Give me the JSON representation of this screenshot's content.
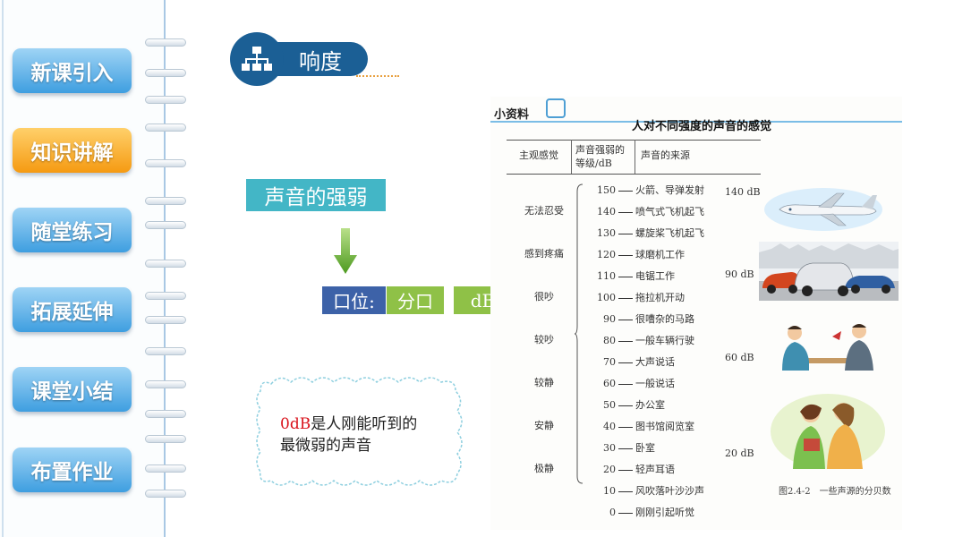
{
  "nav": {
    "items": [
      {
        "label": "新课引入",
        "active": false
      },
      {
        "label": "知识讲解",
        "active": true
      },
      {
        "label": "随堂练习",
        "active": false
      },
      {
        "label": "拓展延伸",
        "active": false
      },
      {
        "label": "课堂小结",
        "active": false
      },
      {
        "label": "布置作业",
        "active": false
      }
    ]
  },
  "topic": {
    "title": "响度",
    "icon": "hierarchy-icon"
  },
  "concept": {
    "label": "声音的强弱",
    "unit_label": "口位:",
    "unit_name": "分口",
    "unit_symbol": "dB"
  },
  "note": {
    "highlight": "0dB",
    "rest_line1": "是人刚能听到的",
    "line2": "最微弱的声音"
  },
  "card": {
    "tag": "小资料",
    "title": "人对不同强度的声音的感觉",
    "headers": {
      "feel": "主观感觉",
      "level": "声音强弱的等级/dB",
      "source": "声音的来源"
    },
    "feelings": [
      "无法忍受",
      "感到疼痛",
      "很吵",
      "较吵",
      "较静",
      "安静",
      "极静"
    ],
    "rows": [
      {
        "level": "150",
        "source": "火箭、导弹发射"
      },
      {
        "level": "140",
        "source": "喷气式飞机起飞"
      },
      {
        "level": "130",
        "source": "螺旋桨飞机起飞"
      },
      {
        "level": "120",
        "source": "球磨机工作"
      },
      {
        "level": "110",
        "source": "电锯工作"
      },
      {
        "level": "100",
        "source": "拖拉机开动"
      },
      {
        "level": "90",
        "source": "很嘈杂的马路"
      },
      {
        "level": "80",
        "source": "一般车辆行驶"
      },
      {
        "level": "70",
        "source": "大声说话"
      },
      {
        "level": "60",
        "source": "一般说话"
      },
      {
        "level": "50",
        "source": "办公室"
      },
      {
        "level": "40",
        "source": "图书馆阅览室"
      },
      {
        "level": "30",
        "source": "卧室"
      },
      {
        "level": "20",
        "source": "轻声耳语"
      },
      {
        "level": "10",
        "source": "风吹落叶沙沙声"
      },
      {
        "level": "0",
        "source": "刚刚引起听觉"
      }
    ],
    "image_tags": [
      "140 dB",
      "90 dB",
      "60 dB",
      "20 dB"
    ],
    "caption": "图2.4-2　一些声源的分贝数"
  },
  "colors": {
    "nav_blue": "#3e9ee0",
    "nav_active": "#f59a12",
    "topic": "#1b5f95",
    "concept": "#43b6c6",
    "unit_green": "#8fc147",
    "unit_blue": "#3d62a8",
    "highlight": "#d9121b"
  }
}
